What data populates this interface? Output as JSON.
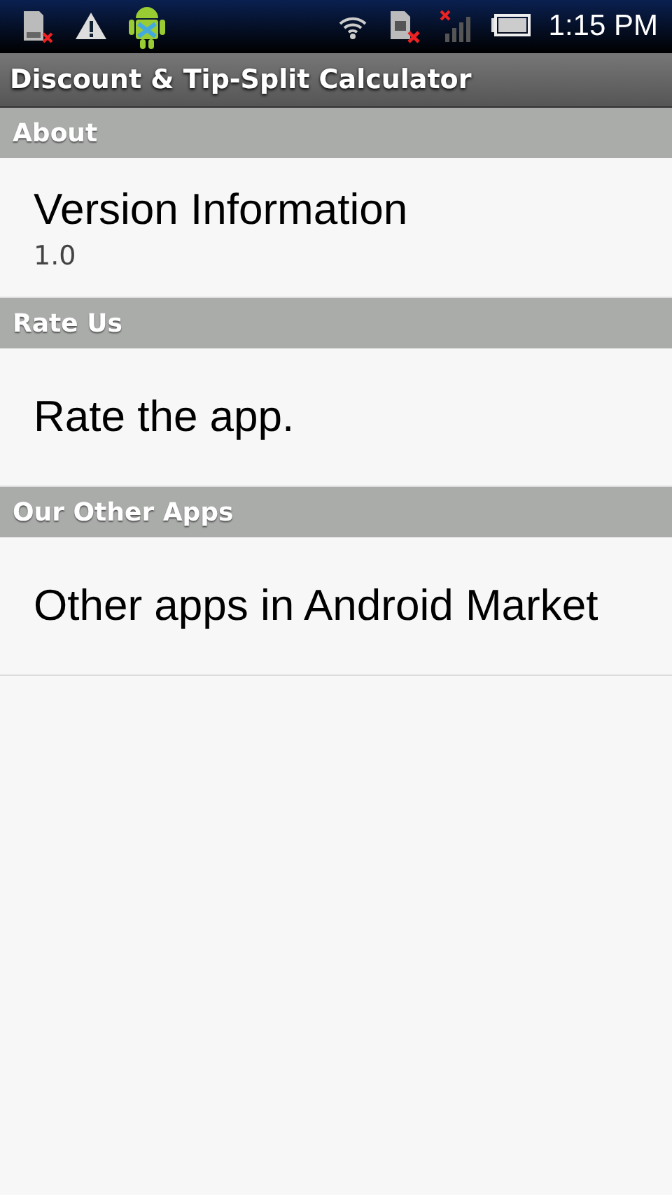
{
  "status_bar": {
    "time": "1:15 PM"
  },
  "window": {
    "title": "Discount & Tip-Split Calculator"
  },
  "sections": [
    {
      "header": "About",
      "items": [
        {
          "title": "Version Information",
          "summary": "1.0"
        }
      ]
    },
    {
      "header": "Rate Us",
      "items": [
        {
          "title": "Rate the app."
        }
      ]
    },
    {
      "header": "Our Other Apps",
      "items": [
        {
          "title": "Other apps in Android Market"
        }
      ]
    }
  ]
}
